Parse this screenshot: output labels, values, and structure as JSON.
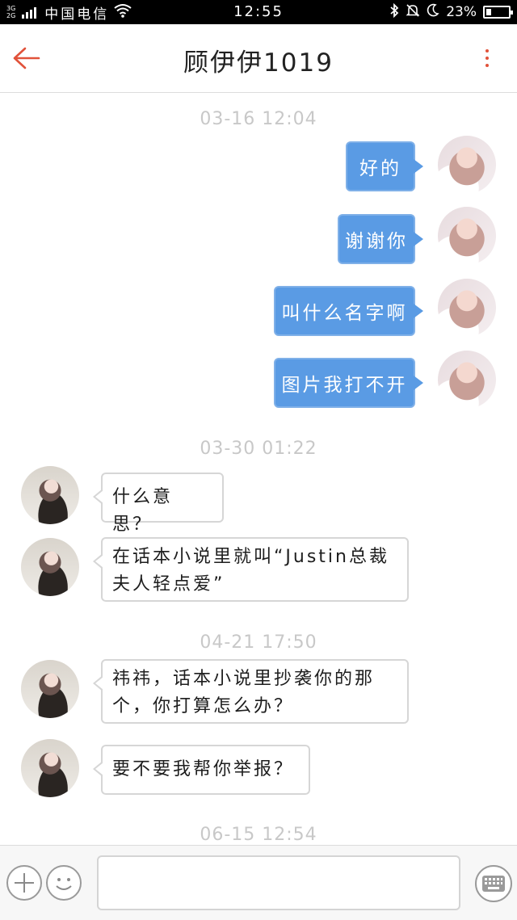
{
  "status_bar": {
    "network_top": "3G",
    "network_bottom": "2G",
    "carrier": "中国电信",
    "time": "12:55",
    "battery": "23%",
    "battery_level": 0.23,
    "icons": [
      "signal-icon",
      "wifi-icon",
      "bluetooth-icon",
      "mute-icon",
      "moon-icon",
      "battery-icon"
    ]
  },
  "header": {
    "title": "顾伊伊1019",
    "back_icon": "arrow-left-icon",
    "more_icon": "more-vertical-icon",
    "accent": "#e1523a"
  },
  "timestamps": [
    "03-16 12:04",
    "03-30 01:22",
    "04-21 17:50",
    "06-15 12:54"
  ],
  "outgoing_messages": [
    "好的",
    "谢谢你",
    "叫什么名字啊",
    "图片我打不开"
  ],
  "incoming_messages": [
    "什么意思？",
    "在话本小说里就叫“Justin总裁夫人轻点爱”",
    "祎祎，话本小说里抄袭你的那个，你打算怎么办？",
    "要不要我帮你举报？"
  ],
  "input_bar": {
    "placeholder": "",
    "add_icon": "plus-icon",
    "emoji_icon": "emoji-icon",
    "keyboard_icon": "keyboard-icon"
  },
  "colors": {
    "outgoing_bubble": "#5a9be4",
    "timestamp": "#c8c8c8",
    "background": "#ffffff"
  }
}
